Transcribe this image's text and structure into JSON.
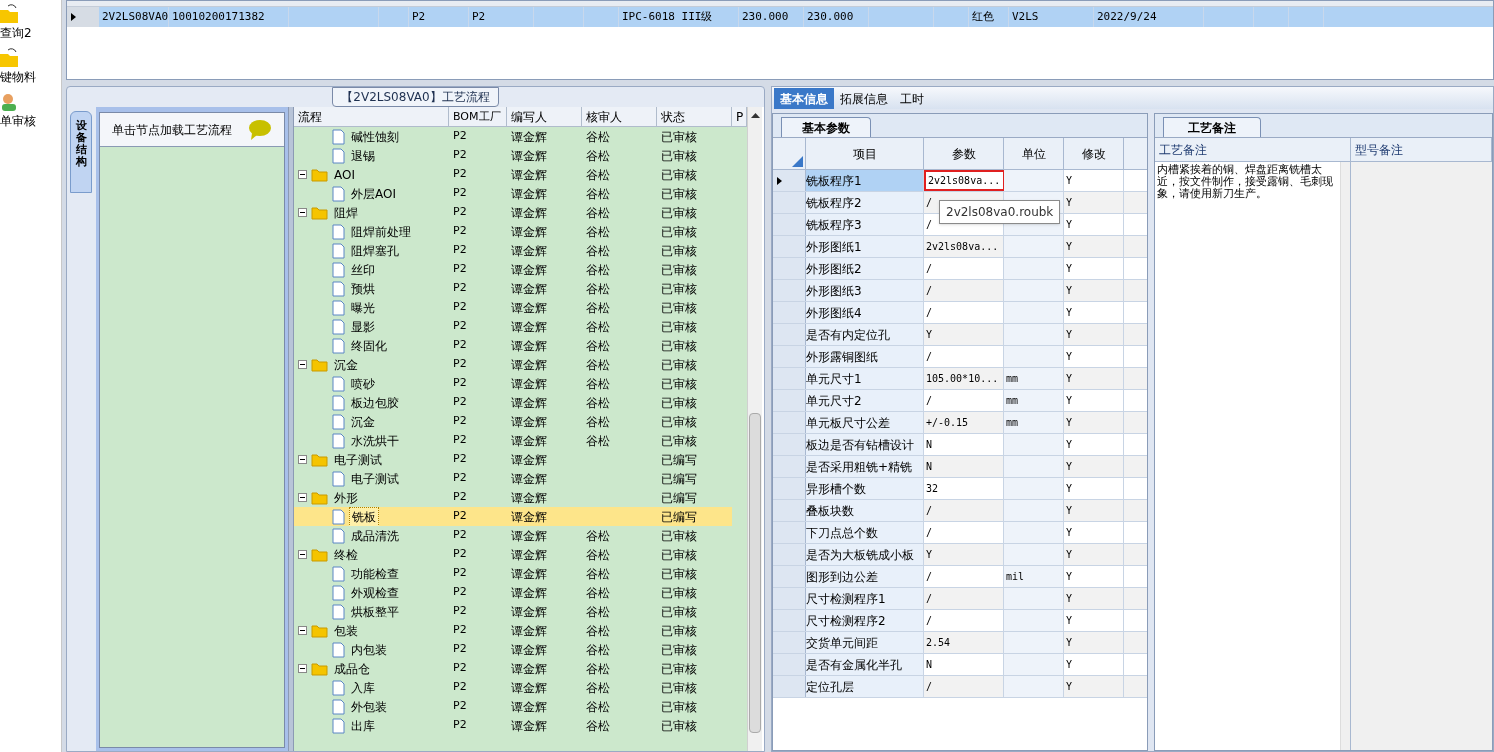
{
  "sidebar": {
    "items": [
      {
        "label": "查询2"
      },
      {
        "label": "键物料"
      },
      {
        "label": "单审核"
      }
    ]
  },
  "top_grid": {
    "rows": [
      {
        "selected": true,
        "cells": [
          "2V2LS08VA0",
          "10010200171382",
          "",
          "",
          "P2",
          "P2",
          "",
          "",
          "IPC-6018 III级",
          "230.000",
          "230.000",
          "",
          "",
          "红色",
          "V2LS",
          "2022/9/24",
          "",
          "",
          ""
        ]
      }
    ]
  },
  "flow_panel": {
    "title": "【2V2LS08VA0】工艺流程",
    "side_tab": "设备结构",
    "hint": "单击节点加载工艺流程",
    "columns": [
      "流程",
      "BOM工厂",
      "编写人",
      "核审人",
      "状态",
      "P"
    ],
    "tree": [
      {
        "kind": "continued",
        "children": [
          {
            "kind": "step",
            "label": "碱性蚀刻",
            "factory": "P2",
            "writer": "谭金辉",
            "reviewer": "谷松",
            "status": "已审核",
            "selected": false
          },
          {
            "kind": "step",
            "label": "退锡",
            "factory": "P2",
            "writer": "谭金辉",
            "reviewer": "谷松",
            "status": "已审核",
            "selected": false
          }
        ]
      },
      {
        "kind": "group",
        "label": "AOI",
        "factory": "P2",
        "writer": "谭金辉",
        "reviewer": "谷松",
        "status": "已审核",
        "selected": false,
        "expanded": true,
        "children": [
          {
            "kind": "step",
            "label": "外层AOI",
            "factory": "P2",
            "writer": "谭金辉",
            "reviewer": "谷松",
            "status": "已审核",
            "selected": false
          }
        ]
      },
      {
        "kind": "group",
        "label": "阻焊",
        "factory": "P2",
        "writer": "谭金辉",
        "reviewer": "谷松",
        "status": "已审核",
        "selected": false,
        "expanded": true,
        "children": [
          {
            "kind": "step",
            "label": "阻焊前处理",
            "factory": "P2",
            "writer": "谭金辉",
            "reviewer": "谷松",
            "status": "已审核",
            "selected": false
          },
          {
            "kind": "step",
            "label": "阻焊塞孔",
            "factory": "P2",
            "writer": "谭金辉",
            "reviewer": "谷松",
            "status": "已审核",
            "selected": false
          },
          {
            "kind": "step",
            "label": "丝印",
            "factory": "P2",
            "writer": "谭金辉",
            "reviewer": "谷松",
            "status": "已审核",
            "selected": false
          },
          {
            "kind": "step",
            "label": "预烘",
            "factory": "P2",
            "writer": "谭金辉",
            "reviewer": "谷松",
            "status": "已审核",
            "selected": false
          },
          {
            "kind": "step",
            "label": "曝光",
            "factory": "P2",
            "writer": "谭金辉",
            "reviewer": "谷松",
            "status": "已审核",
            "selected": false
          },
          {
            "kind": "step",
            "label": "显影",
            "factory": "P2",
            "writer": "谭金辉",
            "reviewer": "谷松",
            "status": "已审核",
            "selected": false
          },
          {
            "kind": "step",
            "label": "终固化",
            "factory": "P2",
            "writer": "谭金辉",
            "reviewer": "谷松",
            "status": "已审核",
            "selected": false
          }
        ]
      },
      {
        "kind": "group",
        "label": "沉金",
        "factory": "P2",
        "writer": "谭金辉",
        "reviewer": "谷松",
        "status": "已审核",
        "selected": false,
        "expanded": true,
        "children": [
          {
            "kind": "step",
            "label": "喷砂",
            "factory": "P2",
            "writer": "谭金辉",
            "reviewer": "谷松",
            "status": "已审核",
            "selected": false
          },
          {
            "kind": "step",
            "label": "板边包胶",
            "factory": "P2",
            "writer": "谭金辉",
            "reviewer": "谷松",
            "status": "已审核",
            "selected": false
          },
          {
            "kind": "step",
            "label": "沉金",
            "factory": "P2",
            "writer": "谭金辉",
            "reviewer": "谷松",
            "status": "已审核",
            "selected": false
          },
          {
            "kind": "step",
            "label": "水洗烘干",
            "factory": "P2",
            "writer": "谭金辉",
            "reviewer": "谷松",
            "status": "已审核",
            "selected": false
          }
        ]
      },
      {
        "kind": "group",
        "label": "电子测试",
        "factory": "P2",
        "writer": "谭金辉",
        "status": "已编写",
        "selected": false,
        "expanded": true,
        "children": [
          {
            "kind": "step",
            "label": "电子测试",
            "factory": "P2",
            "writer": "谭金辉",
            "status": "已编写",
            "selected": false
          }
        ]
      },
      {
        "kind": "group",
        "label": "外形",
        "factory": "P2",
        "writer": "谭金辉",
        "status": "已编写",
        "selected": false,
        "expanded": true,
        "children": [
          {
            "kind": "step",
            "label": "铣板",
            "factory": "P2",
            "writer": "谭金辉",
            "status": "已编写",
            "selected": true
          },
          {
            "kind": "step",
            "label": "成品清洗",
            "factory": "P2",
            "writer": "谭金辉",
            "reviewer": "谷松",
            "status": "已审核",
            "selected": false
          }
        ]
      },
      {
        "kind": "group",
        "label": "终检",
        "factory": "P2",
        "writer": "谭金辉",
        "reviewer": "谷松",
        "status": "已审核",
        "selected": false,
        "expanded": true,
        "children": [
          {
            "kind": "step",
            "label": "功能检查",
            "factory": "P2",
            "writer": "谭金辉",
            "reviewer": "谷松",
            "status": "已审核",
            "selected": false
          },
          {
            "kind": "step",
            "label": "外观检查",
            "factory": "P2",
            "writer": "谭金辉",
            "reviewer": "谷松",
            "status": "已审核",
            "selected": false
          },
          {
            "kind": "step",
            "label": "烘板整平",
            "factory": "P2",
            "writer": "谭金辉",
            "reviewer": "谷松",
            "status": "已审核",
            "selected": false
          }
        ]
      },
      {
        "kind": "group",
        "label": "包装",
        "factory": "P2",
        "writer": "谭金辉",
        "reviewer": "谷松",
        "status": "已审核",
        "selected": false,
        "expanded": true,
        "children": [
          {
            "kind": "step",
            "label": "内包装",
            "factory": "P2",
            "writer": "谭金辉",
            "reviewer": "谷松",
            "status": "已审核",
            "selected": false
          }
        ]
      },
      {
        "kind": "group",
        "label": "成品仓",
        "factory": "P2",
        "writer": "谭金辉",
        "reviewer": "谷松",
        "status": "已审核",
        "selected": false,
        "expanded": true,
        "children": [
          {
            "kind": "step",
            "label": "入库",
            "factory": "P2",
            "writer": "谭金辉",
            "reviewer": "谷松",
            "status": "已审核",
            "selected": false
          },
          {
            "kind": "step",
            "label": "外包装",
            "factory": "P2",
            "writer": "谭金辉",
            "reviewer": "谷松",
            "status": "已审核",
            "selected": false
          },
          {
            "kind": "step",
            "label": "出库",
            "factory": "P2",
            "writer": "谭金辉",
            "reviewer": "谷松",
            "status": "已审核",
            "selected": false
          }
        ]
      }
    ]
  },
  "info_panel": {
    "tabs": [
      {
        "label": "基本信息",
        "selected": true
      },
      {
        "label": "拓展信息",
        "selected": false
      },
      {
        "label": "工时",
        "selected": false
      }
    ],
    "params": {
      "tab": "基本参数",
      "columns": [
        "项目",
        "参数",
        "单位",
        "修改"
      ],
      "tooltip": "2v2ls08va0.roubk",
      "rows": [
        {
          "item": "铣板程序1",
          "value": "2v2ls08va...",
          "unit": "",
          "edit": "Y",
          "selected": true,
          "flagged": true
        },
        {
          "item": "铣板程序2",
          "value": "/",
          "unit": "",
          "edit": "Y",
          "selected": false,
          "flagged": false
        },
        {
          "item": "铣板程序3",
          "value": "/",
          "unit": "",
          "edit": "Y",
          "selected": false,
          "flagged": false
        },
        {
          "item": "外形图纸1",
          "value": "2v2ls08va...",
          "unit": "",
          "edit": "Y",
          "selected": false,
          "flagged": false
        },
        {
          "item": "外形图纸2",
          "value": "/",
          "unit": "",
          "edit": "Y",
          "selected": false,
          "flagged": false
        },
        {
          "item": "外形图纸3",
          "value": "/",
          "unit": "",
          "edit": "Y",
          "selected": false,
          "flagged": false
        },
        {
          "item": "外形图纸4",
          "value": "/",
          "unit": "",
          "edit": "Y",
          "selected": false,
          "flagged": false
        },
        {
          "item": "是否有内定位孔",
          "value": "Y",
          "unit": "",
          "edit": "Y",
          "selected": false,
          "flagged": false
        },
        {
          "item": "外形露铜图纸",
          "value": "/",
          "unit": "",
          "edit": "Y",
          "selected": false,
          "flagged": false
        },
        {
          "item": "单元尺寸1",
          "value": "105.00*10...",
          "unit": "mm",
          "edit": "Y",
          "selected": false,
          "flagged": false
        },
        {
          "item": "单元尺寸2",
          "value": "/",
          "unit": "mm",
          "edit": "Y",
          "selected": false,
          "flagged": false
        },
        {
          "item": "单元板尺寸公差",
          "value": "+/-0.15",
          "unit": "mm",
          "edit": "Y",
          "selected": false,
          "flagged": false
        },
        {
          "item": "板边是否有钻槽设计",
          "value": "N",
          "unit": "",
          "edit": "Y",
          "selected": false,
          "flagged": false
        },
        {
          "item": "是否采用粗铣+精铣",
          "value": "N",
          "unit": "",
          "edit": "Y",
          "selected": false,
          "flagged": false
        },
        {
          "item": "异形槽个数",
          "value": "32",
          "unit": "",
          "edit": "Y",
          "selected": false,
          "flagged": false
        },
        {
          "item": "叠板块数",
          "value": "/",
          "unit": "",
          "edit": "Y",
          "selected": false,
          "flagged": false
        },
        {
          "item": "下刀点总个数",
          "value": "/",
          "unit": "",
          "edit": "Y",
          "selected": false,
          "flagged": false
        },
        {
          "item": "是否为大板铣成小板",
          "value": "Y",
          "unit": "",
          "edit": "Y",
          "selected": false,
          "flagged": false
        },
        {
          "item": "图形到边公差",
          "value": "/",
          "unit": "mil",
          "edit": "Y",
          "selected": false,
          "flagged": false
        },
        {
          "item": "尺寸检测程序1",
          "value": "/",
          "unit": "",
          "edit": "Y",
          "selected": false,
          "flagged": false
        },
        {
          "item": "尺寸检测程序2",
          "value": "/",
          "unit": "",
          "edit": "Y",
          "selected": false,
          "flagged": false
        },
        {
          "item": "交货单元间距",
          "value": "2.54",
          "unit": "",
          "edit": "Y",
          "selected": false,
          "flagged": false
        },
        {
          "item": "是否有金属化半孔",
          "value": "N",
          "unit": "",
          "edit": "Y",
          "selected": false,
          "flagged": false
        },
        {
          "item": "定位孔层",
          "value": "/",
          "unit": "",
          "edit": "Y",
          "selected": false,
          "flagged": false
        }
      ]
    },
    "remarks": {
      "tab": "工艺备注",
      "columns": [
        "工艺备注",
        "型号备注"
      ],
      "text": "内槽紧挨着的铜、焊盘距离铣槽太近，按文件制作，接受露铜、毛刺现象，请使用新刀生产。"
    }
  }
}
